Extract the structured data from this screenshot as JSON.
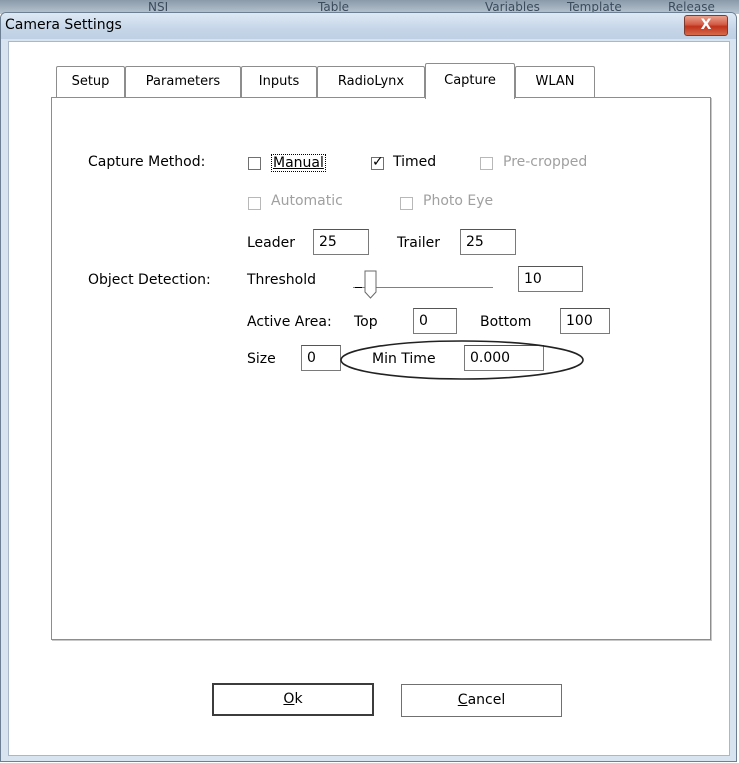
{
  "window": {
    "title": "Camera Settings",
    "close_symbol": "X",
    "background_text": [
      "NSI",
      "Table",
      "Variables",
      "Template",
      "Release"
    ]
  },
  "tabs": [
    {
      "label": "Setup",
      "active": false
    },
    {
      "label": "Parameters",
      "active": false
    },
    {
      "label": "Inputs",
      "active": false
    },
    {
      "label": "RadioLynx",
      "active": false
    },
    {
      "label": "Capture",
      "active": true
    },
    {
      "label": "WLAN",
      "active": false
    }
  ],
  "capture": {
    "capture_method_label": "Capture Method:",
    "options": {
      "manual": {
        "label": "Manual",
        "checked": false,
        "enabled": true
      },
      "timed": {
        "label": "Timed",
        "checked": true,
        "enabled": true
      },
      "precropped": {
        "label": "Pre-cropped",
        "checked": false,
        "enabled": false
      },
      "automatic": {
        "label": "Automatic",
        "checked": false,
        "enabled": false
      },
      "photo_eye": {
        "label": "Photo Eye",
        "checked": false,
        "enabled": false
      }
    },
    "check_mark": "✓",
    "leader_label": "Leader",
    "leader_value": "25",
    "trailer_label": "Trailer",
    "trailer_value": "25",
    "object_detection_label": "Object Detection:",
    "threshold_label": "Threshold",
    "threshold_value": "10",
    "active_area_label": "Active Area:",
    "top_label": "Top",
    "top_value": "0",
    "bottom_label": "Bottom",
    "bottom_value": "100",
    "size_label": "Size",
    "size_value": "0",
    "min_time_label": "Min Time",
    "min_time_value": "0.000"
  },
  "buttons": {
    "ok_prefix": "O",
    "ok_rest": "k",
    "cancel_prefix": "C",
    "cancel_rest": "ancel"
  },
  "colors": {
    "title_bar": "#c6d6e8",
    "close_button": "#c0321c",
    "annotation_ellipse": "#000000"
  }
}
